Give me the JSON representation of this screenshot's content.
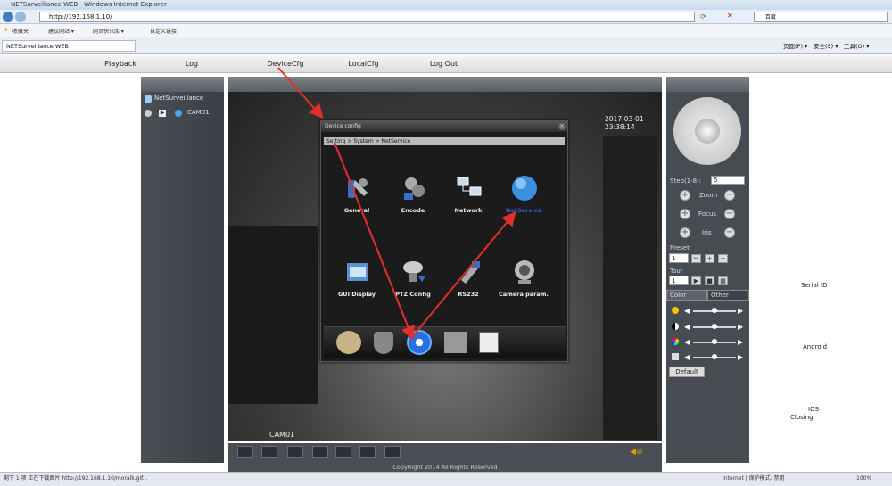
{
  "browser": {
    "title": "NETSurveillance WEB - Windows Internet Explorer",
    "address": "http://192.168.1.10/",
    "favorites_label": "收藏夹",
    "fav_links": [
      "建议网站 ▾",
      "网页快讯库 ▾",
      "自定义链接"
    ],
    "tab_label": "NETSurveillance WEB",
    "search_placeholder": "百度",
    "command_bar": [
      "页面(P) ▾",
      "安全(S) ▾",
      "工具(O) ▾"
    ]
  },
  "nav": [
    "Playback",
    "Log",
    "DeviceCfg",
    "LocalCfg",
    "Log Out"
  ],
  "left_panel": {
    "title": "NetSurveillance",
    "camera": "CAM01"
  },
  "video": {
    "timestamp": "2017-03-01 23:38:14",
    "cam_label": "CAM01"
  },
  "dialog": {
    "title": "Device config",
    "breadcrumb": "Setting > System > NetService",
    "items": [
      {
        "label": "General",
        "icon": "wrench-icon"
      },
      {
        "label": "Encode",
        "icon": "encode-icon"
      },
      {
        "label": "Network",
        "icon": "network-icon"
      },
      {
        "label": "NetService",
        "icon": "globe-icon"
      },
      {
        "label": "GUI Display",
        "icon": "gui-display-icon"
      },
      {
        "label": "PTZ Config",
        "icon": "ptz-camera-icon"
      },
      {
        "label": "RS232",
        "icon": "rs232-icon"
      },
      {
        "label": "Camera param.",
        "icon": "camera-param-icon"
      }
    ]
  },
  "ptz": {
    "step_label": "Step(1-8):",
    "step_value": "5",
    "zoom": "Zoom",
    "focus": "Focus",
    "iris": "Iris",
    "preset": "Preset",
    "preset_value": "1",
    "tour": "Tour",
    "tour_value": "1",
    "color_tab": "Color",
    "other_tab": "Other",
    "default_btn": "Default"
  },
  "copyright": "CopyRight 2014 All Rights Reserved",
  "right_labels": {
    "serial": "Serial ID",
    "android": "Android",
    "ios": "IOS",
    "closing": "Closing"
  },
  "status": {
    "left": "剩下 1 项 正在下载图片 http://192.168.1.10/moralk.gif...",
    "zone": "Internet | 保护模式: 禁用",
    "zoom": "100%"
  },
  "colors": {
    "arrow": "#e0302a",
    "netservice_label": "#3a5fd0"
  }
}
